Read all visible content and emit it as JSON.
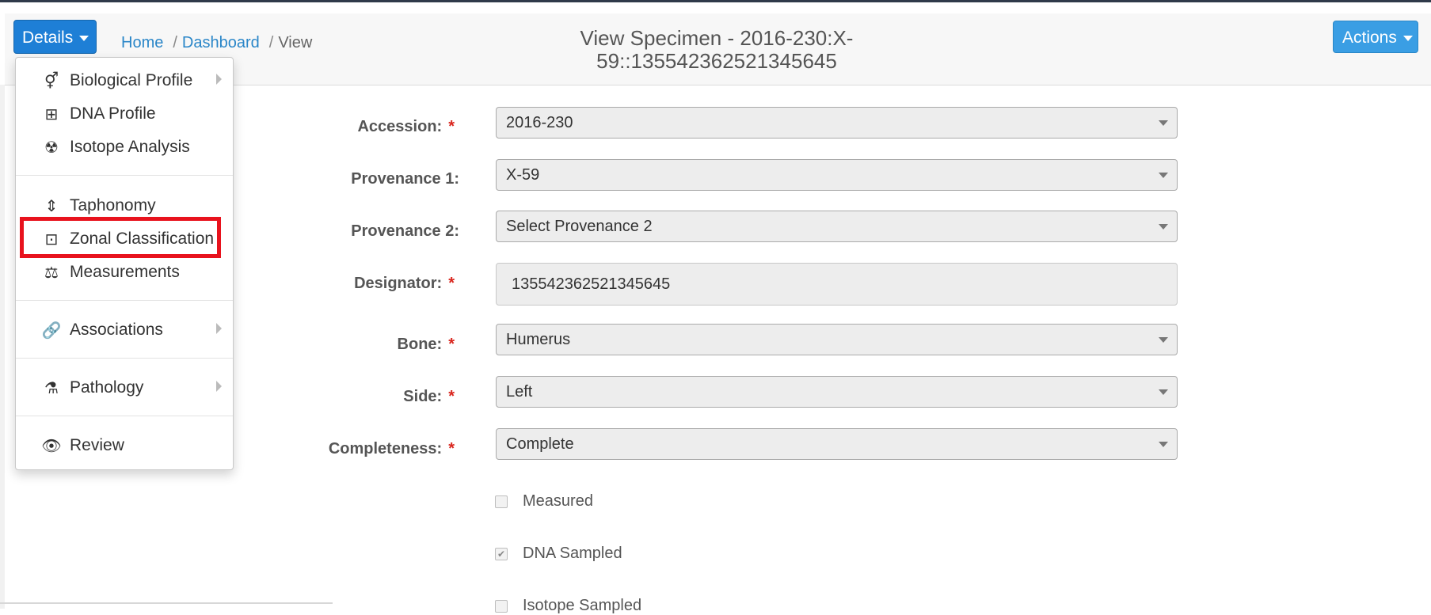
{
  "header": {
    "details_label": "Details",
    "actions_label": "Actions",
    "breadcrumb": {
      "home": "Home",
      "dashboard": "Dashboard",
      "current": "View",
      "separator": "/"
    },
    "title_line1": "View Specimen - 2016-230:X-",
    "title_line2": "59::135542362521345645"
  },
  "menu": {
    "items": [
      {
        "label": "Biological Profile",
        "icon": "gender-icon"
      },
      {
        "label": "DNA Profile",
        "icon": "medkit-icon"
      },
      {
        "label": "Isotope Analysis",
        "icon": "radiation-icon"
      },
      {
        "label": "Taphonomy",
        "icon": "text-height-icon"
      },
      {
        "label": "Zonal Classification",
        "icon": "object-ungroup-icon"
      },
      {
        "label": "Measurements",
        "icon": "balance-scale-icon"
      },
      {
        "label": "Associations",
        "icon": "link-icon"
      },
      {
        "label": "Pathology",
        "icon": "flask-icon"
      },
      {
        "label": "Review",
        "icon": "eye-icon"
      }
    ]
  },
  "form": {
    "required_mark": "*",
    "accession": {
      "label": "Accession:",
      "value": "2016-230"
    },
    "provenance1": {
      "label": "Provenance 1:",
      "value": "X-59"
    },
    "provenance2": {
      "label": "Provenance 2:",
      "value": "Select Provenance 2"
    },
    "designator": {
      "label": "Designator:",
      "value": "135542362521345645"
    },
    "bone": {
      "label": "Bone:",
      "value": "Humerus"
    },
    "side": {
      "label": "Side:",
      "value": "Left"
    },
    "completeness": {
      "label": "Completeness:",
      "value": "Complete"
    },
    "measured": {
      "label": "Measured",
      "checked": false
    },
    "dna_sampled": {
      "label": "DNA Sampled",
      "checked": true
    },
    "isotope_sampled": {
      "label": "Isotope Sampled",
      "checked": false
    }
  },
  "colors": {
    "primary": "#1e7fd6",
    "actions": "#3a9ee4",
    "highlight": "#e8121d",
    "required": "#d9251d"
  }
}
